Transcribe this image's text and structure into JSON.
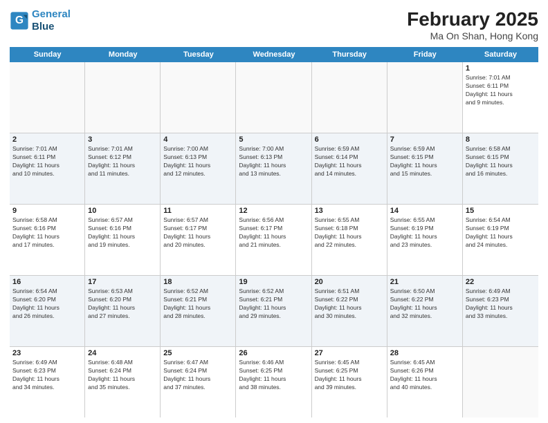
{
  "header": {
    "logo_line1": "General",
    "logo_line2": "Blue",
    "title": "February 2025",
    "subtitle": "Ma On Shan, Hong Kong"
  },
  "dayHeaders": [
    "Sunday",
    "Monday",
    "Tuesday",
    "Wednesday",
    "Thursday",
    "Friday",
    "Saturday"
  ],
  "weeks": [
    {
      "days": [
        {
          "num": "",
          "info": "",
          "empty": true
        },
        {
          "num": "",
          "info": "",
          "empty": true
        },
        {
          "num": "",
          "info": "",
          "empty": true
        },
        {
          "num": "",
          "info": "",
          "empty": true
        },
        {
          "num": "",
          "info": "",
          "empty": true
        },
        {
          "num": "",
          "info": "",
          "empty": true
        },
        {
          "num": "1",
          "info": "Sunrise: 7:01 AM\nSunset: 6:11 PM\nDaylight: 11 hours\nand 9 minutes.",
          "empty": false
        }
      ]
    },
    {
      "days": [
        {
          "num": "2",
          "info": "Sunrise: 7:01 AM\nSunset: 6:11 PM\nDaylight: 11 hours\nand 10 minutes.",
          "empty": false
        },
        {
          "num": "3",
          "info": "Sunrise: 7:01 AM\nSunset: 6:12 PM\nDaylight: 11 hours\nand 11 minutes.",
          "empty": false
        },
        {
          "num": "4",
          "info": "Sunrise: 7:00 AM\nSunset: 6:13 PM\nDaylight: 11 hours\nand 12 minutes.",
          "empty": false
        },
        {
          "num": "5",
          "info": "Sunrise: 7:00 AM\nSunset: 6:13 PM\nDaylight: 11 hours\nand 13 minutes.",
          "empty": false
        },
        {
          "num": "6",
          "info": "Sunrise: 6:59 AM\nSunset: 6:14 PM\nDaylight: 11 hours\nand 14 minutes.",
          "empty": false
        },
        {
          "num": "7",
          "info": "Sunrise: 6:59 AM\nSunset: 6:15 PM\nDaylight: 11 hours\nand 15 minutes.",
          "empty": false
        },
        {
          "num": "8",
          "info": "Sunrise: 6:58 AM\nSunset: 6:15 PM\nDaylight: 11 hours\nand 16 minutes.",
          "empty": false
        }
      ]
    },
    {
      "days": [
        {
          "num": "9",
          "info": "Sunrise: 6:58 AM\nSunset: 6:16 PM\nDaylight: 11 hours\nand 17 minutes.",
          "empty": false
        },
        {
          "num": "10",
          "info": "Sunrise: 6:57 AM\nSunset: 6:16 PM\nDaylight: 11 hours\nand 19 minutes.",
          "empty": false
        },
        {
          "num": "11",
          "info": "Sunrise: 6:57 AM\nSunset: 6:17 PM\nDaylight: 11 hours\nand 20 minutes.",
          "empty": false
        },
        {
          "num": "12",
          "info": "Sunrise: 6:56 AM\nSunset: 6:17 PM\nDaylight: 11 hours\nand 21 minutes.",
          "empty": false
        },
        {
          "num": "13",
          "info": "Sunrise: 6:55 AM\nSunset: 6:18 PM\nDaylight: 11 hours\nand 22 minutes.",
          "empty": false
        },
        {
          "num": "14",
          "info": "Sunrise: 6:55 AM\nSunset: 6:19 PM\nDaylight: 11 hours\nand 23 minutes.",
          "empty": false
        },
        {
          "num": "15",
          "info": "Sunrise: 6:54 AM\nSunset: 6:19 PM\nDaylight: 11 hours\nand 24 minutes.",
          "empty": false
        }
      ]
    },
    {
      "days": [
        {
          "num": "16",
          "info": "Sunrise: 6:54 AM\nSunset: 6:20 PM\nDaylight: 11 hours\nand 26 minutes.",
          "empty": false
        },
        {
          "num": "17",
          "info": "Sunrise: 6:53 AM\nSunset: 6:20 PM\nDaylight: 11 hours\nand 27 minutes.",
          "empty": false
        },
        {
          "num": "18",
          "info": "Sunrise: 6:52 AM\nSunset: 6:21 PM\nDaylight: 11 hours\nand 28 minutes.",
          "empty": false
        },
        {
          "num": "19",
          "info": "Sunrise: 6:52 AM\nSunset: 6:21 PM\nDaylight: 11 hours\nand 29 minutes.",
          "empty": false
        },
        {
          "num": "20",
          "info": "Sunrise: 6:51 AM\nSunset: 6:22 PM\nDaylight: 11 hours\nand 30 minutes.",
          "empty": false
        },
        {
          "num": "21",
          "info": "Sunrise: 6:50 AM\nSunset: 6:22 PM\nDaylight: 11 hours\nand 32 minutes.",
          "empty": false
        },
        {
          "num": "22",
          "info": "Sunrise: 6:49 AM\nSunset: 6:23 PM\nDaylight: 11 hours\nand 33 minutes.",
          "empty": false
        }
      ]
    },
    {
      "days": [
        {
          "num": "23",
          "info": "Sunrise: 6:49 AM\nSunset: 6:23 PM\nDaylight: 11 hours\nand 34 minutes.",
          "empty": false
        },
        {
          "num": "24",
          "info": "Sunrise: 6:48 AM\nSunset: 6:24 PM\nDaylight: 11 hours\nand 35 minutes.",
          "empty": false
        },
        {
          "num": "25",
          "info": "Sunrise: 6:47 AM\nSunset: 6:24 PM\nDaylight: 11 hours\nand 37 minutes.",
          "empty": false
        },
        {
          "num": "26",
          "info": "Sunrise: 6:46 AM\nSunset: 6:25 PM\nDaylight: 11 hours\nand 38 minutes.",
          "empty": false
        },
        {
          "num": "27",
          "info": "Sunrise: 6:45 AM\nSunset: 6:25 PM\nDaylight: 11 hours\nand 39 minutes.",
          "empty": false
        },
        {
          "num": "28",
          "info": "Sunrise: 6:45 AM\nSunset: 6:26 PM\nDaylight: 11 hours\nand 40 minutes.",
          "empty": false
        },
        {
          "num": "",
          "info": "",
          "empty": true
        }
      ]
    }
  ]
}
